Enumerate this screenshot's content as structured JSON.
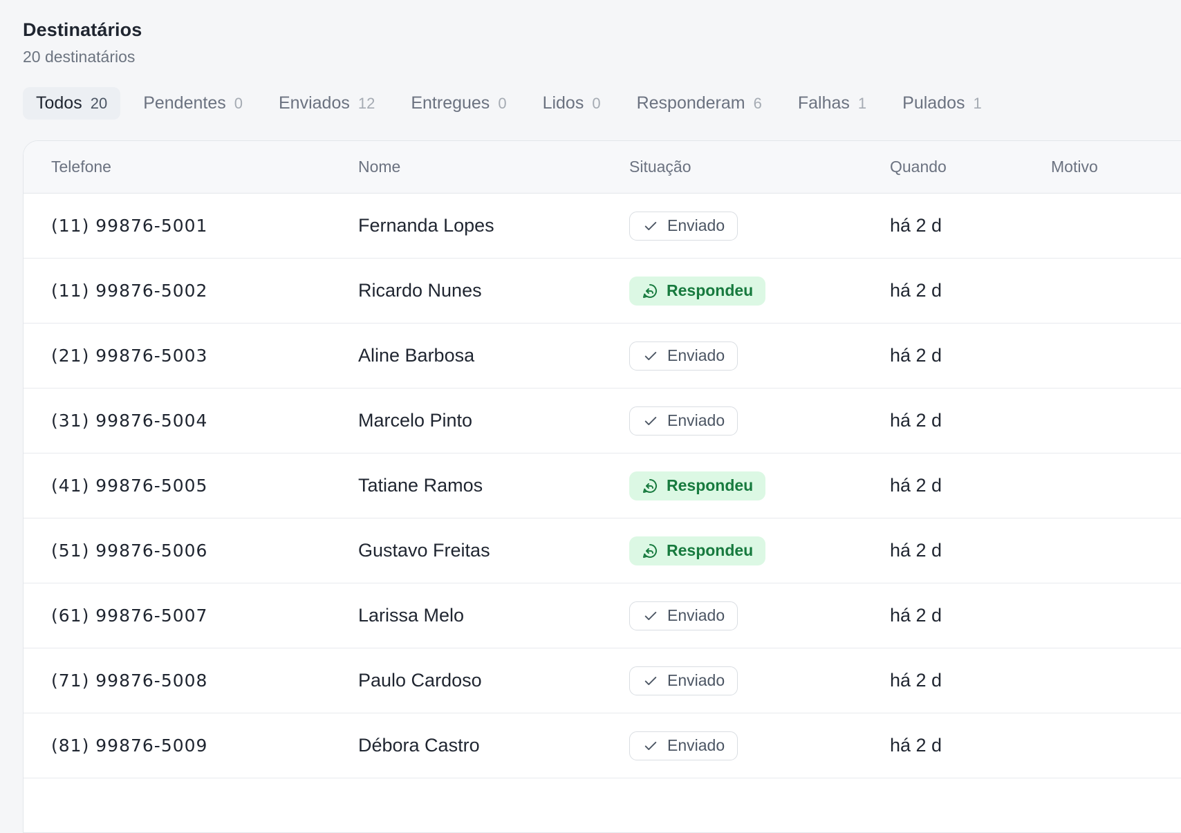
{
  "header": {
    "title": "Destinatários",
    "subtitle": "20 destinatários"
  },
  "tabs": [
    {
      "label": "Todos",
      "count": "20",
      "active": true
    },
    {
      "label": "Pendentes",
      "count": "0"
    },
    {
      "label": "Enviados",
      "count": "12"
    },
    {
      "label": "Entregues",
      "count": "0"
    },
    {
      "label": "Lidos",
      "count": "0"
    },
    {
      "label": "Responderam",
      "count": "6"
    },
    {
      "label": "Falhas",
      "count": "1"
    },
    {
      "label": "Pulados",
      "count": "1"
    }
  ],
  "table": {
    "columns": {
      "phone": "Telefone",
      "name": "Nome",
      "status": "Situação",
      "when": "Quando",
      "reason": "Motivo"
    },
    "rows": [
      {
        "phone": "(11) 99876-5001",
        "name": "Fernanda Lopes",
        "status": "Enviado",
        "status_kind": "sent",
        "when": "há 2 d",
        "reason": ""
      },
      {
        "phone": "(11) 99876-5002",
        "name": "Ricardo Nunes",
        "status": "Respondeu",
        "status_kind": "replied",
        "when": "há 2 d",
        "reason": ""
      },
      {
        "phone": "(21) 99876-5003",
        "name": "Aline Barbosa",
        "status": "Enviado",
        "status_kind": "sent",
        "when": "há 2 d",
        "reason": ""
      },
      {
        "phone": "(31) 99876-5004",
        "name": "Marcelo Pinto",
        "status": "Enviado",
        "status_kind": "sent",
        "when": "há 2 d",
        "reason": ""
      },
      {
        "phone": "(41) 99876-5005",
        "name": "Tatiane Ramos",
        "status": "Respondeu",
        "status_kind": "replied",
        "when": "há 2 d",
        "reason": ""
      },
      {
        "phone": "(51) 99876-5006",
        "name": "Gustavo Freitas",
        "status": "Respondeu",
        "status_kind": "replied",
        "when": "há 2 d",
        "reason": ""
      },
      {
        "phone": "(61) 99876-5007",
        "name": "Larissa Melo",
        "status": "Enviado",
        "status_kind": "sent",
        "when": "há 2 d",
        "reason": ""
      },
      {
        "phone": "(71) 99876-5008",
        "name": "Paulo Cardoso",
        "status": "Enviado",
        "status_kind": "sent",
        "when": "há 2 d",
        "reason": ""
      },
      {
        "phone": "(81) 99876-5009",
        "name": "Débora Castro",
        "status": "Enviado",
        "status_kind": "sent",
        "when": "há 2 d",
        "reason": ""
      }
    ]
  },
  "icons": {
    "sent": "check-icon",
    "replied": "reply-bubble-icon"
  },
  "colors": {
    "replied_bg": "#dcf8e4",
    "replied_text": "#177a3e",
    "sent_border": "#d9dde2"
  }
}
